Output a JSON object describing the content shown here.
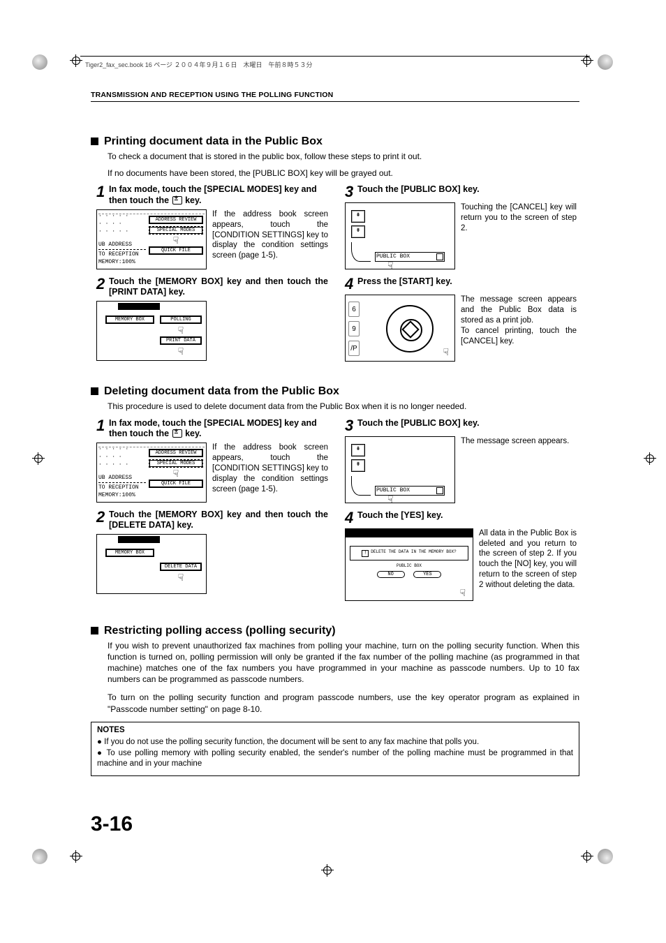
{
  "cropmark_info": "Tiger2_fax_sec.book 16 ページ ２００４年９月１６日　木曜日　午前８時５３分",
  "running_head": "TRANSMISSION AND RECEPTION USING THE POLLING FUNCTION",
  "page_number": "3-16",
  "sec_print": {
    "title": "Printing document data in the Public Box",
    "intro1": "To check a document that is stored in the public box, follow these steps to print it out.",
    "intro2": "If no documents have been stored, the [PUBLIC BOX] key will be grayed out.",
    "step1": "In fax mode, touch the [SPECIAL MODES] key and then touch the",
    "step1_suffix": "key.",
    "step1_desc": "If the address book screen appears, touch the [CONDITION SETTINGS] key to display the condition settings screen (page 1-5).",
    "step2": "Touch the [MEMORY BOX] key and then touch the [PRINT DATA] key.",
    "step3": "Touch the [PUBLIC BOX] key.",
    "step3_desc": "Touching the [CANCEL] key will return you to the screen of step 2.",
    "step4": "Press the [START] key.",
    "step4_desc1": "The message screen appears and the Public Box data is stored as a print job.",
    "step4_desc2": "To cancel printing, touch the [CANCEL] key."
  },
  "sec_delete": {
    "title": "Deleting document data from the Public Box",
    "intro": "This procedure is used to delete document data from the Public Box when it is no longer needed.",
    "step1": "In fax mode, touch the [SPECIAL MODES] key and then touch the",
    "step1_suffix": "key.",
    "step1_desc": "If the address book screen appears, touch the [CONDITION SETTINGS] key to display the condition settings screen (page 1-5).",
    "step2": "Touch the [MEMORY BOX] key and then touch the [DELETE DATA] key.",
    "step3": "Touch the [PUBLIC BOX] key.",
    "step3_desc": "The message screen appears.",
    "step4": "Touch the [YES] key.",
    "step4_desc": "All data in the Public Box is deleted and you return to the screen of step 2.\nIf you touch the [NO] key, you will return to the screen of step 2 without deleting the data."
  },
  "sec_restrict": {
    "title": "Restricting polling access (polling security)",
    "para1": "If you wish to prevent unauthorized fax machines from polling your machine, turn on the polling security function. When this function is turned on, polling permission will only be granted if the fax number of the polling machine (as programmed in that machine) matches one of the fax numbers you have programmed in your machine as passcode numbers. Up to 10 fax numbers can be programmed as passcode numbers.",
    "para2": "To turn on the polling security function and program passcode numbers, use the key operator program as explained in \"Passcode number setting\" on page 8-10."
  },
  "notes": {
    "title": "NOTES",
    "item1": "If you do not use the polling security function, the document will be sent to any fax machine that polls you.",
    "item2": "To use polling memory with polling security enabled, the sender's number of the polling machine must be programmed in that machine and in your machine"
  },
  "panels": {
    "fax": {
      "ub_address": "UB ADDRESS",
      "to_reception": "TO RECEPTION",
      "memory": "MEMORY:100%",
      "address_review": "ADDRESS REVIEW",
      "special_modes": "SPECIAL MODES",
      "quick_file": "QUICK FILE"
    },
    "memory_print": {
      "memory_box": "MEMORY BOX",
      "polling": "POLLING",
      "print_data": "PRINT DATA"
    },
    "memory_delete": {
      "memory_box": "MEMORY BOX",
      "delete_data": "DELETE DATA"
    },
    "public": {
      "label": "PUBLIC BOX"
    },
    "start": {
      "k6": "6",
      "k9": "9",
      "kp": "/P"
    },
    "dialog": {
      "msg": "DELETE THE DATA IN THE MEMORY BOX?",
      "sub": "PUBLIC BOX",
      "no": "NO",
      "yes": "YES"
    }
  }
}
